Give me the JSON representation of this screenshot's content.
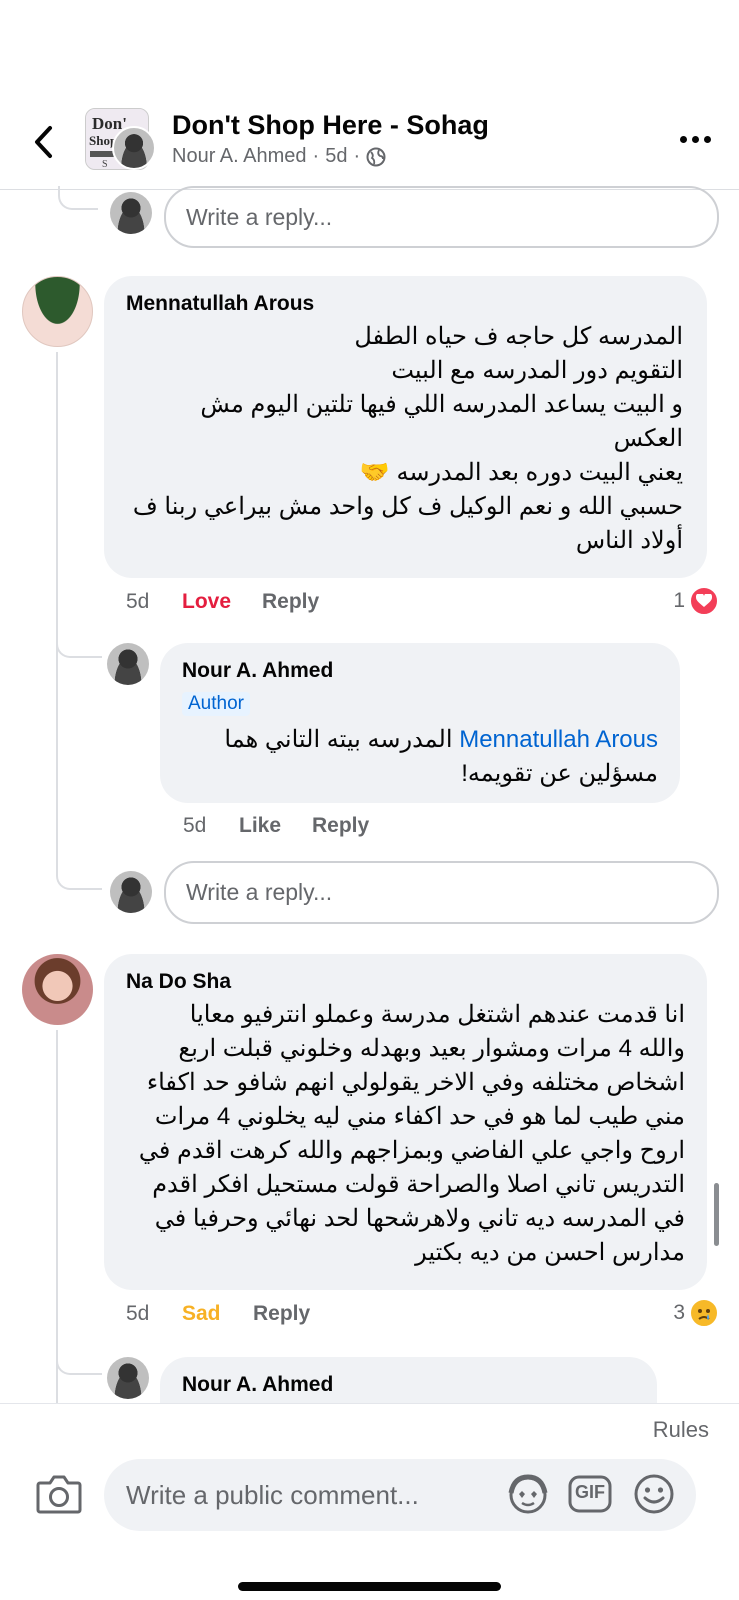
{
  "header": {
    "group_name": "Don't Shop Here - Sohag",
    "author": "Nour A. Ahmed",
    "time": "5d",
    "separator": "·",
    "logo_text": "Don't Shop Here Sohag"
  },
  "reply_placeholder": "Write a reply...",
  "comments": [
    {
      "name": "Mennatullah Arous",
      "lines": [
        "المدرسه كل حاجه ف حياه الطفل",
        "التقويم دور المدرسه مع البيت",
        "و البيت يساعد المدرسه اللي فيها تلتين اليوم مش",
        "العكس",
        "يعني البيت دوره بعد المدرسه 🤝",
        "حسبي الله و نعم الوكيل ف كل واحد مش بيراعي ربنا ف",
        "أولاد الناس"
      ],
      "time": "5d",
      "reaction_label": "Love",
      "reply_label": "Reply",
      "reaction_count": "1"
    },
    {
      "name": "Nour A. Ahmed",
      "badge": "Author",
      "mention": "Mennatullah Arous",
      "line1_rest": " المدرسه بيته التاني هما",
      "line2": "مسؤلين عن تقويمه!",
      "time": "5d",
      "like_label": "Like",
      "reply_label": "Reply"
    },
    {
      "name": "Na Do Sha",
      "lines": [
        "انا قدمت عندهم اشتغل مدرسة وعملو انترفيو معايا",
        "والله 4 مرات ومشوار بعيد وبهدله وخلوني قبلت اربع",
        "اشخاص مختلفه وفي الاخر يقولولي انهم شافو حد اكفاء",
        "مني طيب لما هو في حد اكفاء مني ليه يخلوني 4 مرات",
        "اروح واجي علي الفاضي وبمزاجهم والله كرهت اقدم في",
        "التدريس تاني اصلا والصراحة قولت مستحيل افكر اقدم",
        "في المدرسه ديه تاني ولاهرشحها لحد نهائي وحرفيا في",
        "مدارس احسن من ديه بكتير"
      ],
      "time": "5d",
      "reaction_label": "Sad",
      "reply_label": "Reply",
      "reaction_count": "3"
    },
    {
      "name": "Nour A. Ahmed"
    }
  ],
  "composer": {
    "rules_label": "Rules",
    "placeholder": "Write a public comment...",
    "gif_label": "GIF"
  },
  "colors": {
    "love": "#e41e3f",
    "sad": "#f7b125",
    "link": "#0064d1",
    "bubble": "#f0f2f5"
  }
}
